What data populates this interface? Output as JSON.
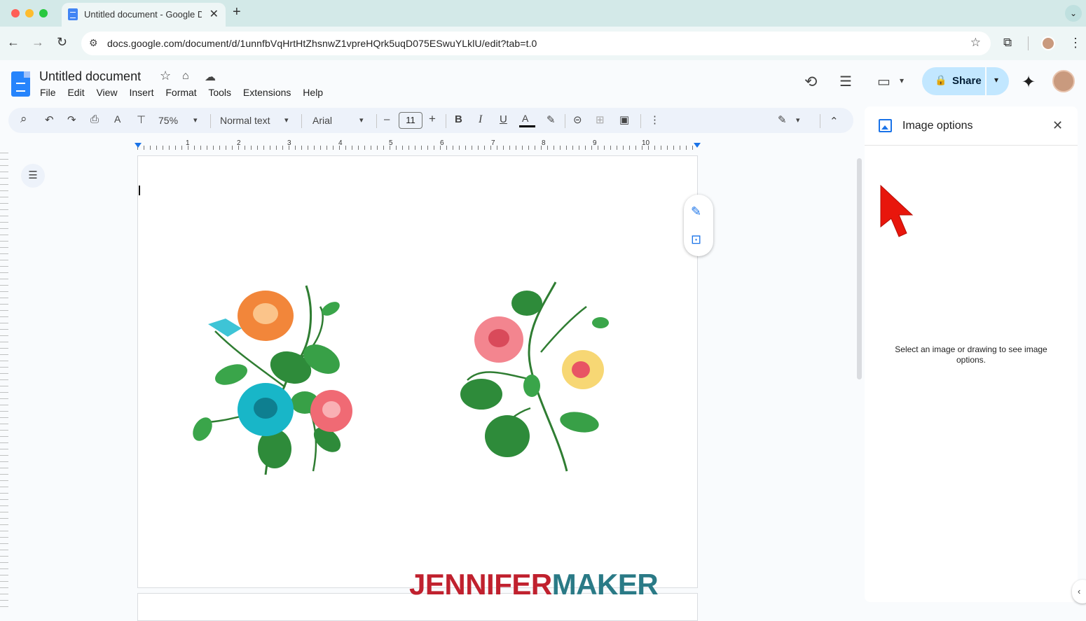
{
  "browser": {
    "tab_title": "Untitled document - Google Docs",
    "tab_close_glyph": "✕",
    "new_tab_glyph": "+",
    "url": "docs.google.com/document/d/1unnfbVqHrtHtZhsnwZ1vpreHQrk5uqD075ESwuYLklU/edit?tab=t.0",
    "back_glyph": "←",
    "forward_glyph": "→",
    "reload_glyph": "↻",
    "bookmark_glyph": "☆",
    "menu_glyph": "⋮",
    "tab_menu_glyph": "⌄",
    "site_info_glyph": "⚙",
    "extensions_glyph": "⧉"
  },
  "docs": {
    "title": "Untitled document",
    "menu": [
      "File",
      "Edit",
      "View",
      "Insert",
      "Format",
      "Tools",
      "Extensions",
      "Help"
    ],
    "share_label": "Share",
    "header_icons": {
      "star": "☆",
      "move": "⌂",
      "cloud": "☁",
      "history": "⟲",
      "comments": "☰",
      "meet": "▭",
      "gemini": "✦",
      "lock": "🔒",
      "dropdown": "▾"
    }
  },
  "toolbar": {
    "zoom": "75%",
    "style": "Normal text",
    "font": "Arial",
    "font_size": "11",
    "glyphs": {
      "search": "⌕",
      "undo": "↶",
      "redo": "↷",
      "print": "⎙",
      "spellcheck": "A",
      "paint_format": "⊤",
      "minus": "–",
      "plus": "+",
      "bold": "B",
      "italic": "I",
      "underline": "U",
      "text_color": "A",
      "highlight": "✎",
      "link": "⊝",
      "comment": "⊞",
      "image": "▣",
      "more": "⋮",
      "editing": "✎",
      "collapse": "⌃",
      "dropdown": "▾"
    }
  },
  "ruler": {
    "numbers": [
      "1",
      "2",
      "3",
      "4",
      "5",
      "6",
      "7",
      "8",
      "9",
      "10"
    ]
  },
  "document": {
    "outline_glyph": "☰",
    "float_actions": {
      "edit_glyph": "✎",
      "suggest_glyph": "⊡"
    }
  },
  "side_panel": {
    "title": "Image options",
    "message": "Select an image or drawing to see image options.",
    "close_glyph": "✕",
    "collapse_glyph": "‹"
  },
  "watermark": {
    "part1": "JENNIFER",
    "part2": "MAKER",
    "color1": "#c0212e",
    "color2": "#2a7a86"
  },
  "colors": {
    "accent": "#1a73e8",
    "share_bg": "#c2e7ff",
    "tabstrip": "#d3e9e8",
    "cursor_arrow": "#e8160c"
  }
}
